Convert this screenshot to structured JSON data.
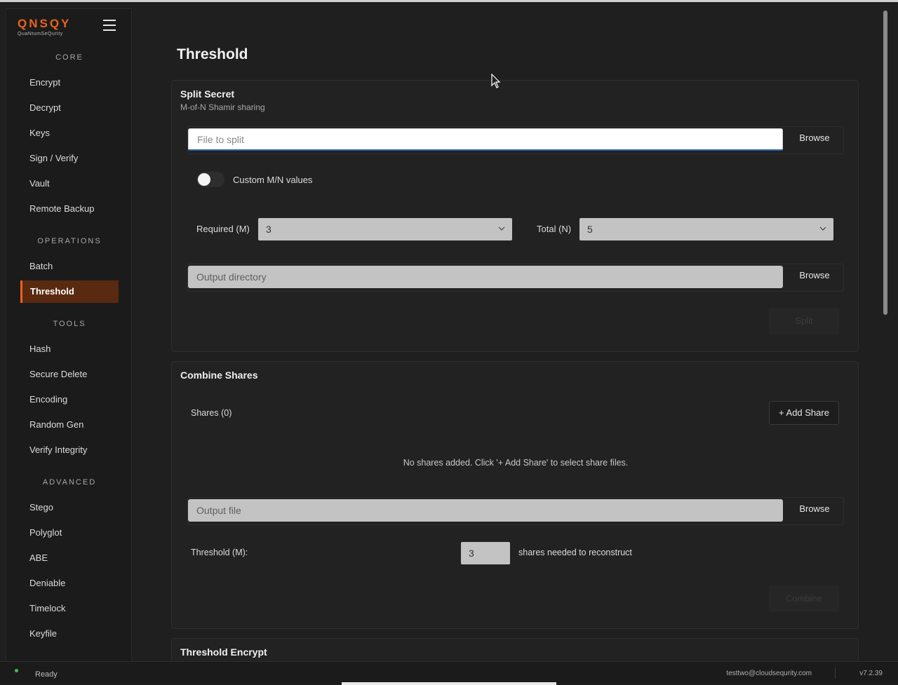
{
  "app": {
    "logo_main": "QNSQY",
    "logo_sub": "QuaNtumSeQurity"
  },
  "sidebar": {
    "sections": [
      {
        "label": "CORE",
        "items": [
          {
            "label": "Encrypt"
          },
          {
            "label": "Decrypt"
          },
          {
            "label": "Keys"
          },
          {
            "label": "Sign / Verify"
          },
          {
            "label": "Vault"
          },
          {
            "label": "Remote Backup"
          }
        ]
      },
      {
        "label": "OPERATIONS",
        "items": [
          {
            "label": "Batch"
          },
          {
            "label": "Threshold",
            "active": true
          }
        ]
      },
      {
        "label": "TOOLS",
        "items": [
          {
            "label": "Hash"
          },
          {
            "label": "Secure Delete"
          },
          {
            "label": "Encoding"
          },
          {
            "label": "Random Gen"
          },
          {
            "label": "Verify Integrity"
          }
        ]
      },
      {
        "label": "ADVANCED",
        "items": [
          {
            "label": "Stego"
          },
          {
            "label": "Polyglot"
          },
          {
            "label": "ABE"
          },
          {
            "label": "Deniable"
          },
          {
            "label": "Timelock"
          },
          {
            "label": "Keyfile"
          }
        ]
      }
    ]
  },
  "page": {
    "title": "Threshold"
  },
  "split": {
    "title": "Split Secret",
    "subtitle": "M-of-N Shamir sharing",
    "file_placeholder": "File to split",
    "browse_label": "Browse",
    "toggle_label": "Custom M/N values",
    "toggle_on": false,
    "required_label": "Required (M)",
    "required_value": "3",
    "total_label": "Total (N)",
    "total_value": "5",
    "output_placeholder": "Output directory",
    "output_browse_label": "Browse",
    "action_label": "Split"
  },
  "combine": {
    "title": "Combine Shares",
    "shares_label": "Shares (0)",
    "add_share_label": "+ Add Share",
    "empty_message": "No shares added. Click '+ Add Share' to select share files.",
    "output_placeholder": "Output file",
    "browse_label": "Browse",
    "threshold_label": "Threshold (M):",
    "threshold_value": "3",
    "threshold_hint": "shares needed to reconstruct",
    "action_label": "Combine"
  },
  "threshold_encrypt": {
    "title": "Threshold Encrypt"
  },
  "statusbar": {
    "status": "Ready",
    "status_color": "#3cc24a",
    "user": "testtwo@cloudsequrity.com",
    "version": "v7.2.39"
  },
  "colors": {
    "accent": "#e8641e",
    "active_bg": "#5a2a10"
  }
}
